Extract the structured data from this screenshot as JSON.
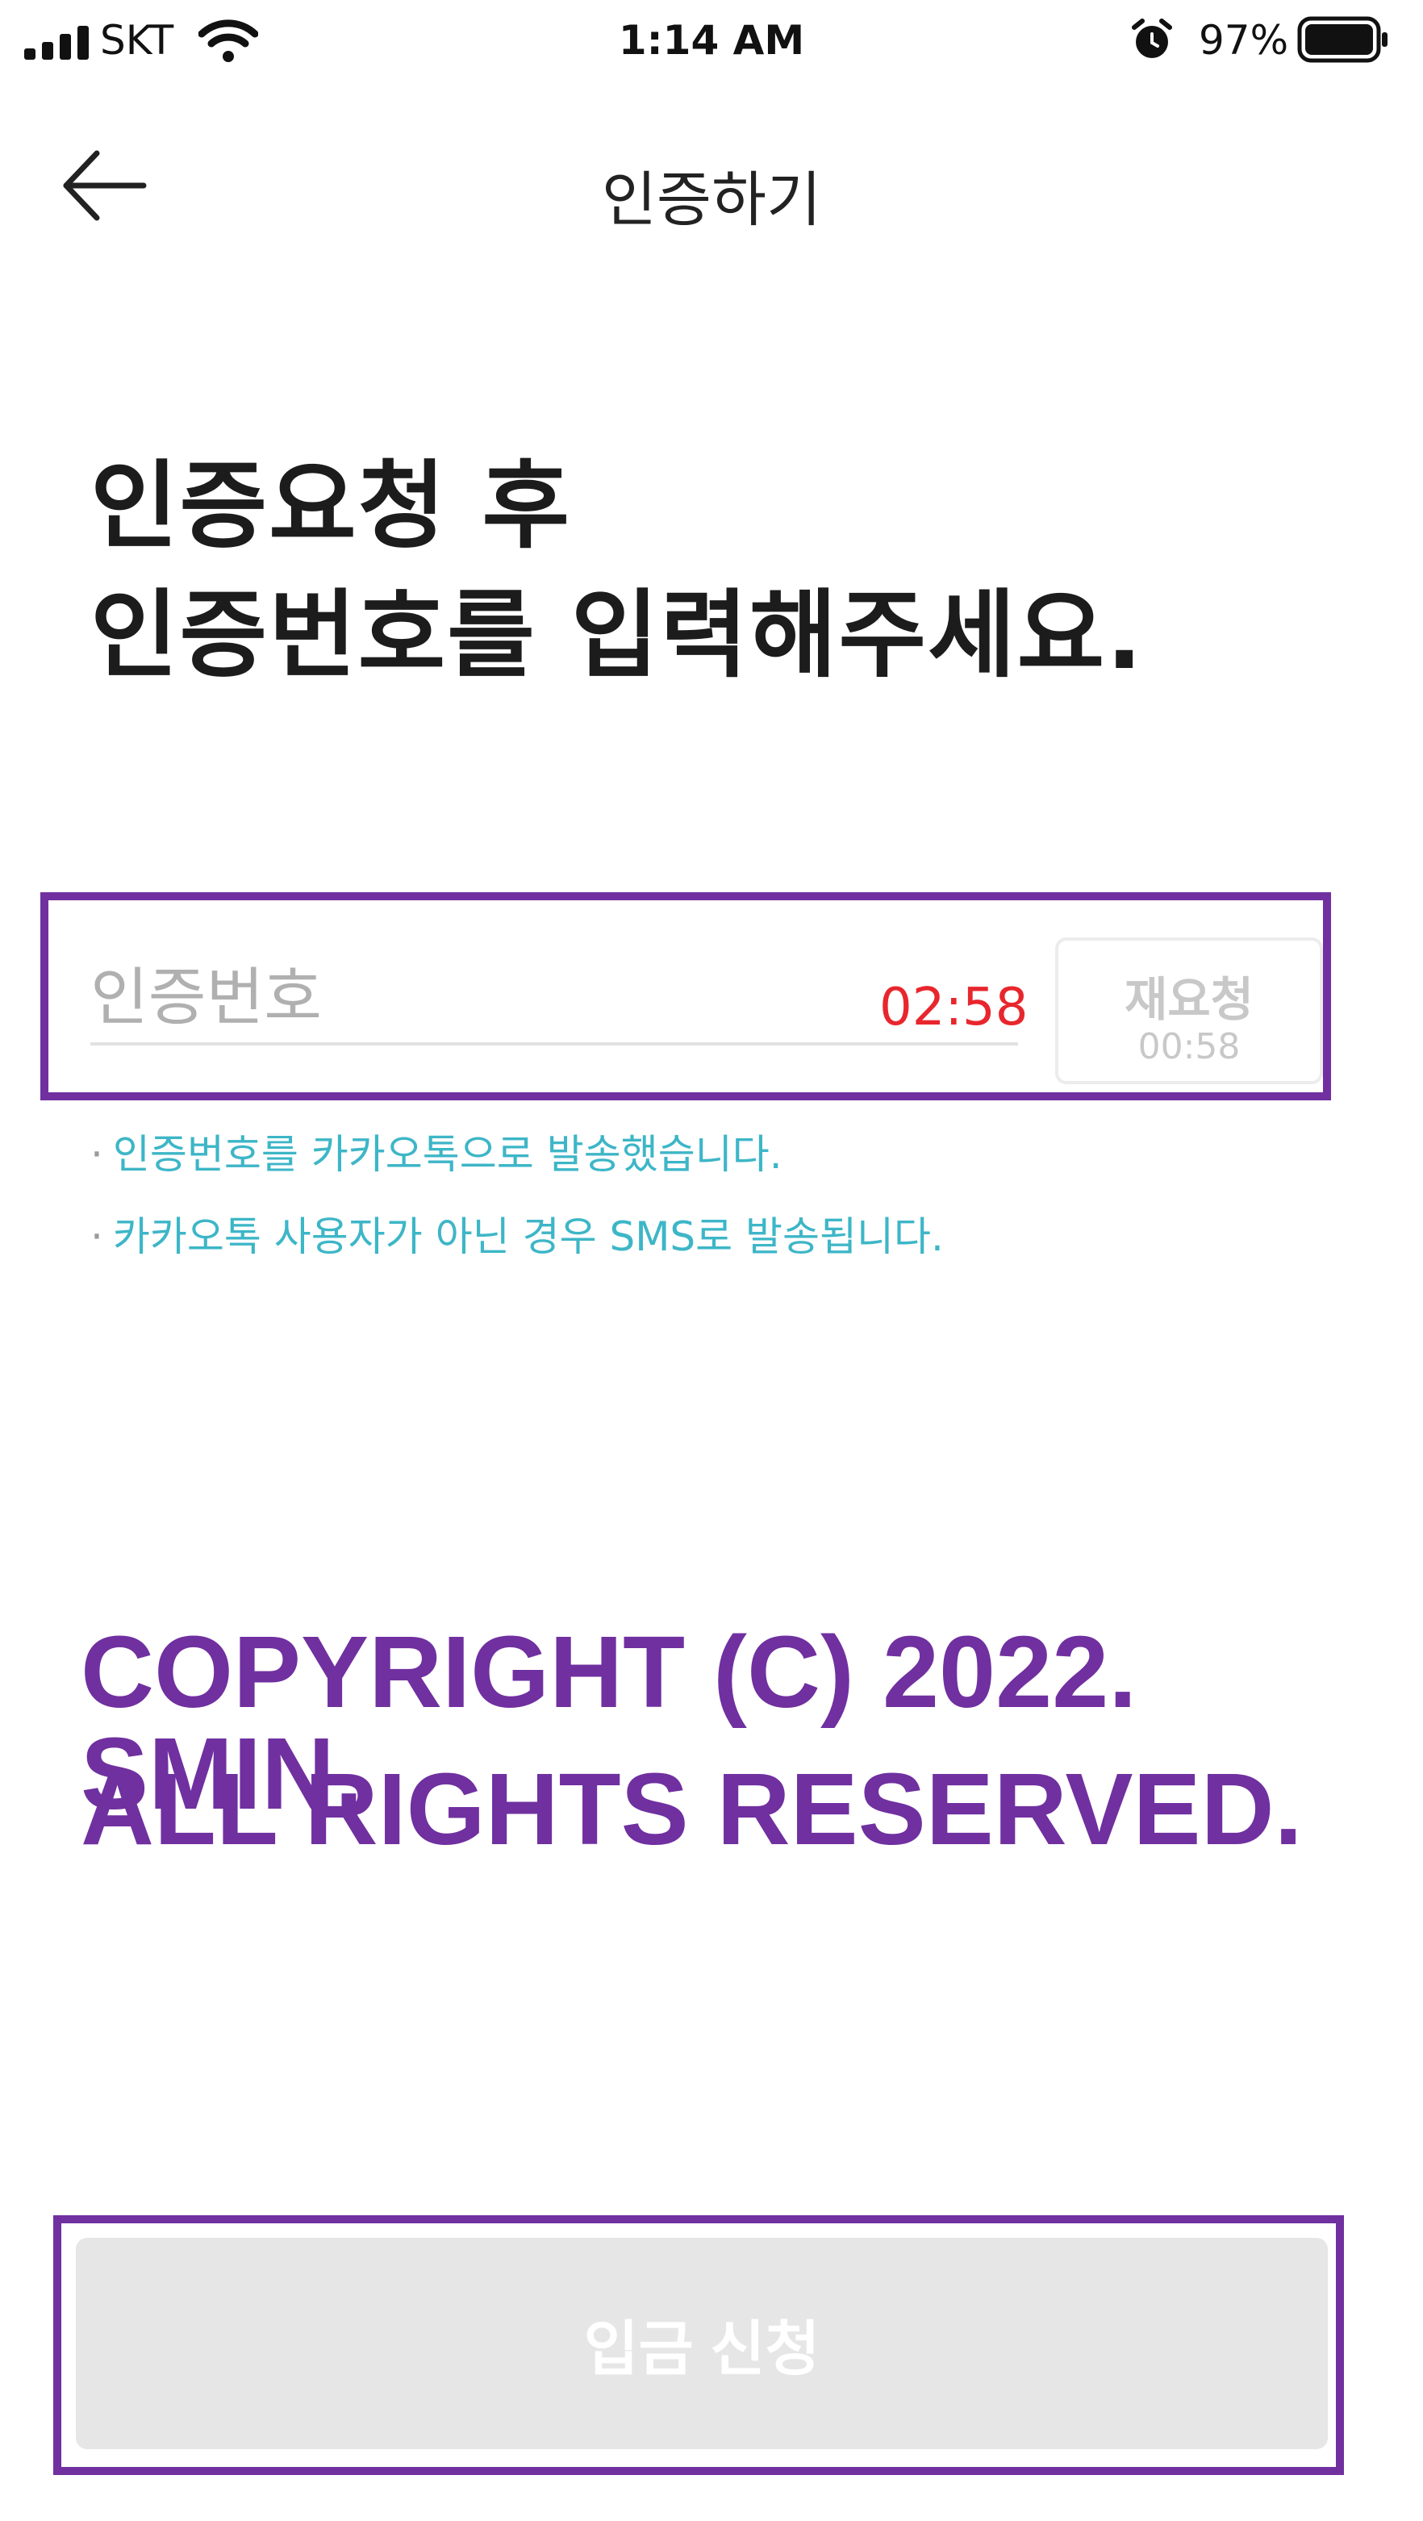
{
  "status_bar": {
    "carrier": "SKT",
    "time": "1:14 AM",
    "battery_percent": "97%",
    "icons": [
      "signal-icon",
      "wifi-icon",
      "alarm-icon",
      "battery-icon"
    ]
  },
  "nav": {
    "title": "인증하기",
    "back_icon": "arrow-left-icon"
  },
  "heading": {
    "line1": "인증요청 후",
    "line2": "인증번호를 입력해주세요."
  },
  "verification": {
    "placeholder": "인증번호",
    "value": "",
    "timer": "02:58",
    "resend_label": "재요청",
    "resend_timer": "00:58"
  },
  "notes": [
    "인증번호를 카카오톡으로 발송했습니다.",
    "카카오톡 사용자가 아닌 경우 SMS로 발송됩니다."
  ],
  "watermark": {
    "line1": "COPYRIGHT (C) 2022. SMIN.",
    "line2": "ALL RIGHTS RESERVED."
  },
  "submit": {
    "label": "입금 신청"
  },
  "colors": {
    "timer": "#e8262d",
    "notes": "#3db6c7",
    "highlight": "#7030a0",
    "disabled_button": "#e6e6e6"
  }
}
